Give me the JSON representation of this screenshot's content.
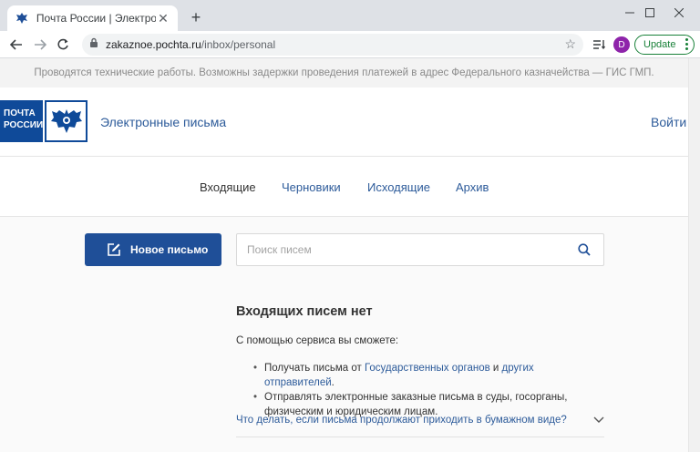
{
  "browser": {
    "tab_title": "Почта России | Электронные пис",
    "url_domain": "zakaznoe.pochta.ru",
    "url_path": "/inbox/personal",
    "avatar_letter": "D",
    "update_label": "Update"
  },
  "notice": "Проводятся технические работы. Возможны задержки проведения платежей в адрес Федерального казначейства — ГИС ГМП.",
  "header": {
    "logo_text_line1": "ПОЧТА",
    "logo_text_line2": "РОССИИ",
    "service_name": "Электронные письма",
    "login_label": "Войти"
  },
  "nav": {
    "items": [
      {
        "label": "Входящие"
      },
      {
        "label": "Черновики"
      },
      {
        "label": "Исходящие"
      },
      {
        "label": "Архив"
      }
    ]
  },
  "actions": {
    "compose_label": "Новое письмо",
    "search_placeholder": "Поиск писем"
  },
  "empty_state": {
    "title": "Входящих писем нет",
    "lead": "С помощью сервиса вы сможете:",
    "bullet1_prefix": "Получать письма от ",
    "bullet1_link1": "Государственных органов",
    "bullet1_mid": " и ",
    "bullet1_link2": "других отправителей",
    "bullet1_suffix": ".",
    "bullet2": "Отправлять электронные заказные письма в суды, госорганы, физическим и юридическим лицам.",
    "faq_question": "Что делать, если письма продолжают приходить в бумажном виде?"
  },
  "colors": {
    "brand_blue": "#1f4f98",
    "link_blue": "#2d5b9a",
    "update_green": "#188038"
  }
}
